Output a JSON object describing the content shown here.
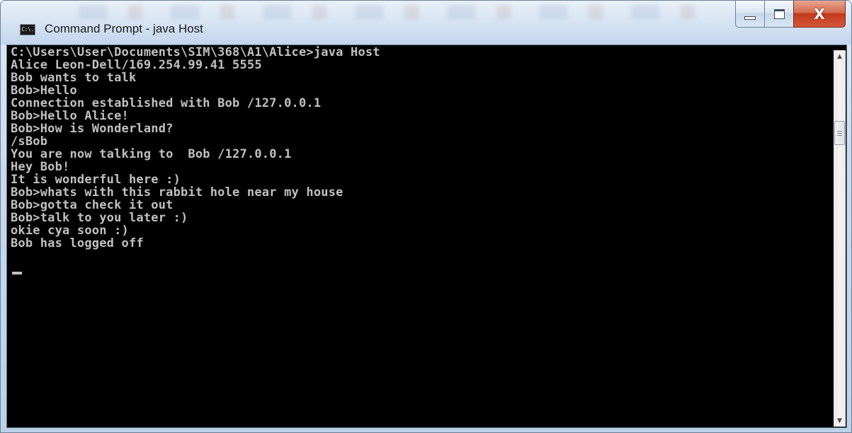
{
  "window": {
    "title": "Command Prompt - java  Host",
    "icon": "command-prompt-icon",
    "icon_text": "C:\\."
  },
  "controls": {
    "minimize": "minimize-icon",
    "maximize": "maximize-icon",
    "close": "close-icon",
    "close_glyph": "X"
  },
  "console": {
    "lines": [
      "C:\\Users\\User\\Documents\\SIM\\368\\A1\\Alice>java Host",
      "Alice Leon-Dell/169.254.99.41 5555",
      "Bob wants to talk",
      "Bob>Hello",
      "Connection established with Bob /127.0.0.1",
      "Bob>Hello Alice!",
      "Bob>How is Wonderland?",
      "/sBob",
      "You are now talking to  Bob /127.0.0.1",
      "Hey Bob!",
      "It is wonderful here :)",
      "Bob>whats with this rabbit hole near my house",
      "Bob>gotta check it out",
      "Bob>talk to you later :)",
      "okie cya soon :)",
      "Bob has logged off"
    ]
  },
  "scrollbar": {
    "up_arrow": "▲",
    "down_arrow": "▼"
  },
  "colors": {
    "console_background": "#000000",
    "console_text": "#c0c0c0",
    "close_button": "#c7432a"
  }
}
